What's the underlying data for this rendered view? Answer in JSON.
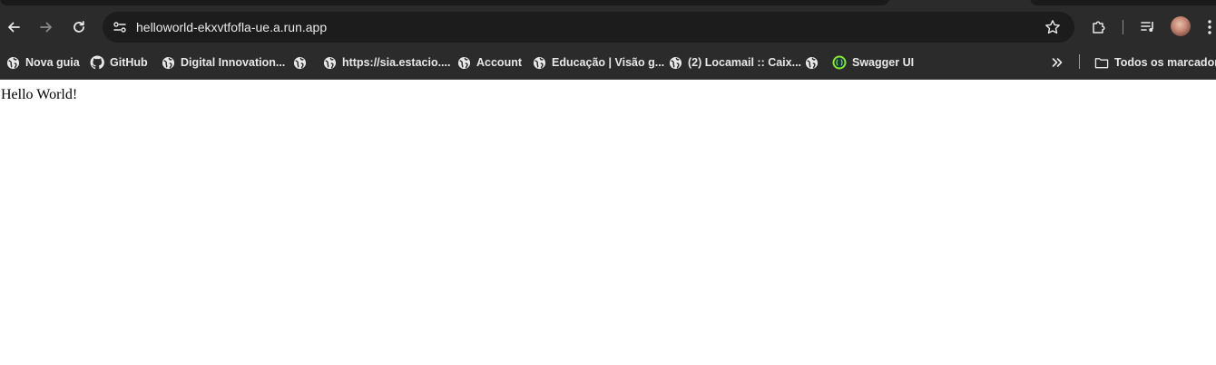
{
  "browser": {
    "address_bar": {
      "url": "helloworld-ekxvtfofla-ue.a.run.app"
    },
    "toolbar_icons": [
      "back-icon",
      "forward-icon",
      "reload-icon",
      "site-info-icon",
      "star-icon",
      "extensions-icon",
      "media-icon",
      "profile-avatar",
      "menu-icon"
    ]
  },
  "bookmarks": {
    "items": [
      {
        "label": "Nova guia",
        "icon": "globe-icon"
      },
      {
        "label": "GitHub",
        "icon": "github-icon"
      },
      {
        "label": "Digital Innovation...",
        "icon": "globe-icon"
      },
      {
        "label": "",
        "icon": "globe-icon"
      },
      {
        "label": "https://sia.estacio....",
        "icon": "globe-icon"
      },
      {
        "label": "Account",
        "icon": "globe-icon"
      },
      {
        "label": "Educação | Visão g...",
        "icon": "globe-icon"
      },
      {
        "label": "(2) Locamail :: Caix...",
        "icon": "globe-icon"
      },
      {
        "label": "",
        "icon": "globe-icon"
      },
      {
        "label": "Swagger UI",
        "icon": "swagger-icon"
      }
    ],
    "overflow_icon": "chevron-double-right-icon",
    "all_bookmarks": {
      "label": "Todos os marcadores",
      "icon": "folder-icon"
    }
  },
  "page": {
    "body_text": "Hello World!"
  },
  "colors": {
    "chrome_bg": "#2b2b2b",
    "omnibox_bg": "#1c1c1c",
    "text_light": "#e8e8e8",
    "swagger_green": "#85ea2d"
  }
}
